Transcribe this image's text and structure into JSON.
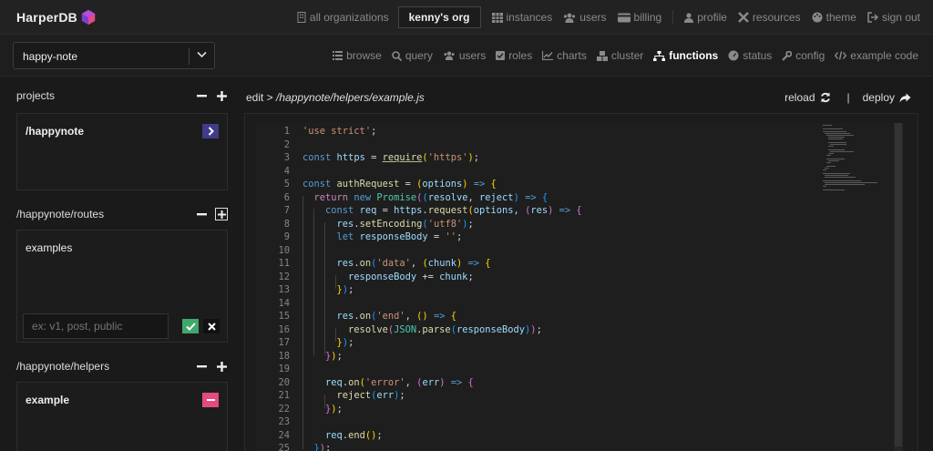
{
  "brand": {
    "name": "HarperDB"
  },
  "topnav": {
    "all_orgs": "all organizations",
    "org": "kenny's org",
    "instances": "instances",
    "users": "users",
    "billing": "billing",
    "profile": "profile",
    "resources": "resources",
    "theme": "theme",
    "signout": "sign out"
  },
  "instance_select": {
    "value": "happy-note"
  },
  "subnav": {
    "browse": "browse",
    "query": "query",
    "users": "users",
    "roles": "roles",
    "charts": "charts",
    "cluster": "cluster",
    "functions": "functions",
    "status": "status",
    "config": "config",
    "example_code": "example code"
  },
  "projects": {
    "title": "projects",
    "items": [
      "/happynote"
    ]
  },
  "routes": {
    "title": "/happynote/routes",
    "items": [
      "examples"
    ],
    "input_placeholder": "ex: v1, post, public"
  },
  "helpers": {
    "title": "/happynote/helpers",
    "items": [
      "example"
    ]
  },
  "editor": {
    "edit_label": "edit > ",
    "file_path": "/happynote/helpers/example.js",
    "reload": "reload",
    "deploy": "deploy",
    "divider": "|",
    "line_numbers": [
      "1",
      "2",
      "3",
      "4",
      "5",
      "6",
      "7",
      "8",
      "9",
      "10",
      "11",
      "12",
      "13",
      "14",
      "15",
      "16",
      "17",
      "18",
      "19",
      "20",
      "21",
      "22",
      "23",
      "24",
      "25"
    ]
  },
  "colors": {
    "accent_purple": "#403b8a",
    "accent_pink": "#e24a80",
    "accent_green": "#40a86a"
  }
}
